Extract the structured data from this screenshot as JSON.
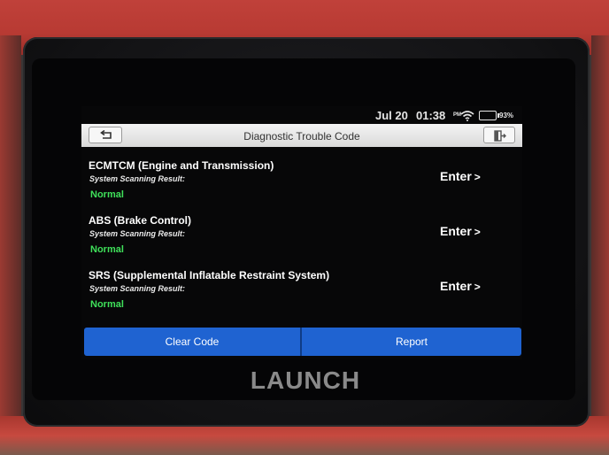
{
  "status": {
    "date": "Jul 20",
    "time": "01:38",
    "ampm": "PM",
    "battery": "93%"
  },
  "header": {
    "title": "Diagnostic Trouble Code"
  },
  "systems": [
    {
      "name": "ECMTCM (Engine and Transmission)",
      "label": "System Scanning Result:",
      "result": "Normal",
      "action": "Enter"
    },
    {
      "name": "ABS (Brake Control)",
      "label": "System Scanning Result:",
      "result": "Normal",
      "action": "Enter"
    },
    {
      "name": "SRS (Supplemental Inflatable Restraint System)",
      "label": "System Scanning Result:",
      "result": "Normal",
      "action": "Enter"
    }
  ],
  "buttons": {
    "clear": "Clear Code",
    "report": "Report"
  },
  "brand": "LAUNCH",
  "colors": {
    "case": "#b83a33",
    "accent_button": "#1f63d1",
    "result_ok": "#3fe05a",
    "title_bar": "#e6e6e6"
  },
  "icons": {
    "back": "back-arrow-icon",
    "exit": "exit-door-icon",
    "wifi": "wifi-icon",
    "battery": "battery-icon"
  }
}
